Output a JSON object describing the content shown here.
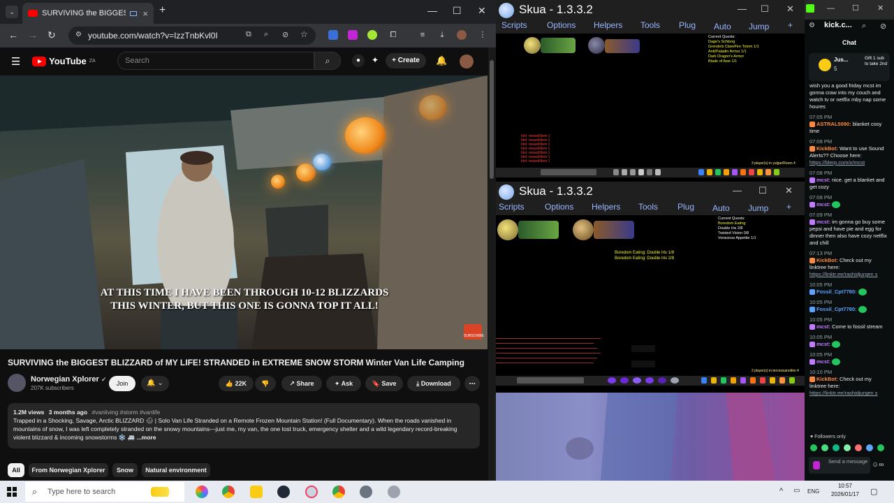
{
  "browser": {
    "tab_title": "SURVIVING the BIGGEST BL",
    "url": "youtube.com/watch?v=IzzTnbKvl0I"
  },
  "youtube": {
    "logo": "YouTube",
    "logo_region": "ZA",
    "search_placeholder": "Search",
    "create_label": "Create",
    "caption_line1": "AT THIS TIME I HAVE BEEN THROUGH 10-12 BLIZZARDS",
    "caption_line2": "THIS WINTER, BUT THIS ONE IS GONNA TOP IT ALL!",
    "subscribe_badge": "SUBSCRIBE",
    "video_title": "SURVIVING the BIGGEST BLIZZARD of MY LIFE! STRANDED in EXTREME SNOW STORM Winter Van Life Camping",
    "channel_name": "Norwegian Xplorer",
    "subscribers": "207K subscribers",
    "join_label": "Join",
    "likes": "22K",
    "share_label": "Share",
    "ask_label": "Ask",
    "save_label": "Save",
    "download_label": "Download",
    "views": "1.2M views",
    "age": "3 months ago",
    "tags": "#vanliving #storm #vanlife",
    "description": "Trapped in a Shocking, Savage, Arctic BLIZZARD 🌨 | Solo Van Life Stranded on a Remote Frozen Mountain Station! (Full Documentary). When the roads vanished in mountains of snow, I was left completely stranded on the snowy mountains—just me, my van, the one lost truck, emergency shelter and a wild legendary record-breaking violent blizzard & incoming snowstorms ❄️ 🚐 ",
    "more_label": "...more",
    "chips": [
      "All",
      "From Norwegian Xplorer",
      "Snow",
      "Natural environment"
    ]
  },
  "skua1": {
    "title": "Skua - 1.3.3.2",
    "menu": [
      "Scripts",
      "Options",
      "Helpers",
      "Tools",
      "Plug",
      "Auto",
      "Jump",
      "+"
    ],
    "quest_header": "Current Quests:",
    "quests": [
      "Dage's Schlong",
      "Grendels Claw/Fire Totem 1/1",
      "Anti/Paladin Armor 1/1",
      "Dark Dragon's Armor",
      "Blade of Awe 1/1"
    ],
    "log_lines": [
      "Idol: reward/Item 1",
      "Idol: reward/Item 1",
      "Idol: reward/Item 1",
      "Idol: reward/Item 1",
      "Idol: reward/Item 1",
      "Idol: reward/Item 1",
      "Idol: reward/Item 1"
    ],
    "players_text": "3 player(s) in yulgar/Room 4"
  },
  "skua2": {
    "title": "Skua - 1.3.3.2",
    "menu": [
      "Scripts",
      "Options",
      "Helpers",
      "Tools",
      "Plug",
      "Auto",
      "Jump",
      "+"
    ],
    "quest_header": "Current Quests:",
    "quests": [
      "Boredom Eating",
      "Double Iris 2/8",
      "Twisted Vision 0/8",
      "Voracious Appetite 1/1"
    ],
    "boredom": [
      "Boredom Eating: Double Iris 1/8",
      "Boredom Eating: Double Iris 2/8"
    ],
    "players_text": "2 player(s) in tercessuinotlim 4"
  },
  "kick": {
    "url": "kick.c...",
    "chat_title": "Chat",
    "pin_user": "Jus...",
    "pin_count": "5",
    "pin_text": "Gift 1 sub to take 2nd",
    "messages": [
      {
        "time": "",
        "user": "",
        "text": "wish you a good friday mcst im gonna craw into my couch and watch tv or netflix mby nap some houres",
        "color": "#eee"
      },
      {
        "time": "07:05 PM",
        "user": "ASTRAL5090:",
        "text": "blanket cosy time",
        "color": "#ff8a3d"
      },
      {
        "time": "07:08 PM",
        "user": "KickBot:",
        "text": "Want to use Sound Alerts?? Choose here: ",
        "link": "https://blerp.com/x/mcst",
        "color": "#ff8a3d"
      },
      {
        "time": "07:08 PM",
        "user": "mcst:",
        "text": "nice. get a blanket and get cozy",
        "color": "#c07bff"
      },
      {
        "time": "07:08 PM",
        "user": "mcst:",
        "text": "",
        "color": "#c07bff"
      },
      {
        "time": "07:09 PM",
        "user": "mcst:",
        "text": "im gonna go buy some pepsi and have pie and egg for dinner then also have cozy netflix and chill",
        "color": "#c07bff"
      },
      {
        "time": "07:13 PM",
        "user": "KickBot:",
        "text": "Check out my linktree here: ",
        "link": "https://linktr.ee/rashidjurgen s",
        "color": "#ff8a3d"
      },
      {
        "time": "10:05 PM",
        "user": "Fossil_Cpt7780:",
        "text": "",
        "color": "#5aa3ff"
      },
      {
        "time": "10:05 PM",
        "user": "Fossil_Cpt7780:",
        "text": "",
        "color": "#5aa3ff"
      },
      {
        "time": "10:05 PM",
        "user": "mcst:",
        "text": "Come to fossil stream",
        "color": "#c07bff"
      },
      {
        "time": "10:05 PM",
        "user": "mcst:",
        "text": "",
        "color": "#c07bff"
      },
      {
        "time": "10:05 PM",
        "user": "mcst:",
        "text": "",
        "color": "#c07bff"
      },
      {
        "time": "10:10 PM",
        "user": "KickBot:",
        "text": "Check out my linktree here: ",
        "link": "https://linktr.ee/rashidjurgen s",
        "color": "#ff8a3d"
      }
    ],
    "followers_only": "Followers only",
    "send_placeholder": "Send a message"
  },
  "taskbar": {
    "search_placeholder": "Type here to search",
    "lang": "ENG",
    "time": "10:57",
    "date": "2026/01/17"
  },
  "colors": {
    "youtube_red": "#ff0000",
    "kick_green": "#53fc18",
    "skua_menu": "#9ab7ff"
  }
}
